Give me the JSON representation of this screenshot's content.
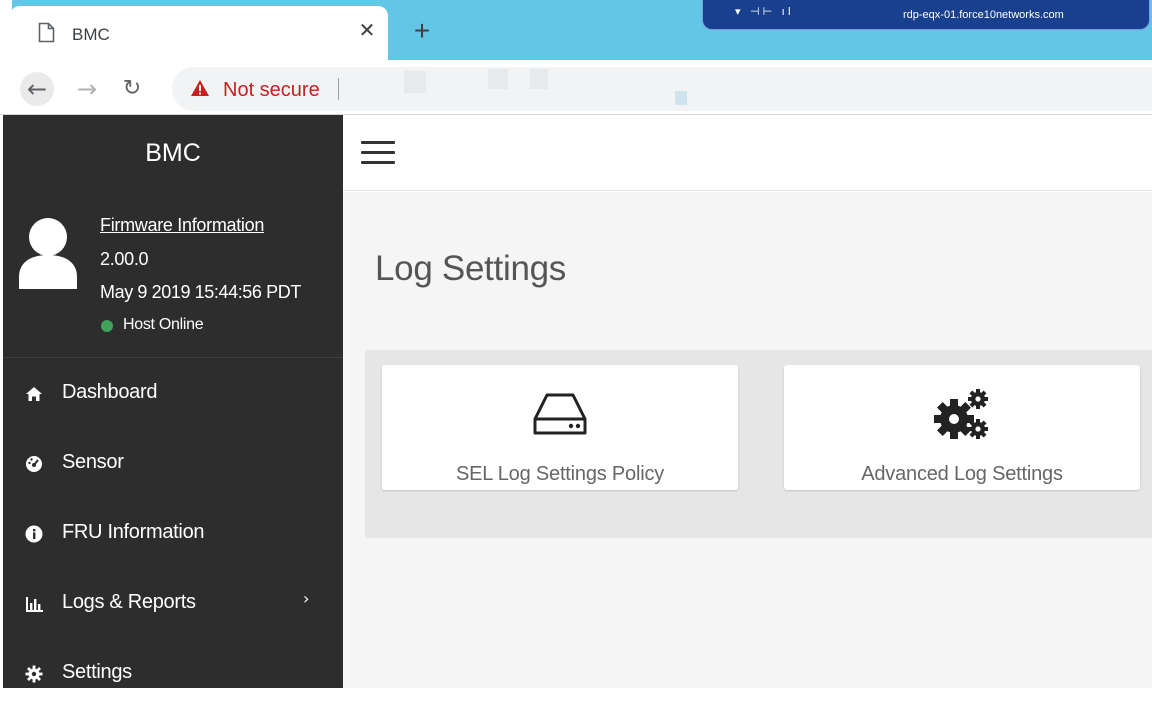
{
  "browser": {
    "tab_title": "BMC",
    "tab_close_icon": "close-icon",
    "new_tab_icon": "plus-icon",
    "security_label": "Not secure",
    "rdp_host": "rdp-eqx-01.force10networks.com"
  },
  "sidebar": {
    "brand": "BMC",
    "firmware": {
      "link_label": "Firmware Information",
      "version": "2.00.0",
      "build_date": "May 9 2019 15:44:56 PDT",
      "host_status": "Host Online",
      "host_status_color": "#3fa35c"
    },
    "items": [
      {
        "label": "Dashboard",
        "icon": "home-icon"
      },
      {
        "label": "Sensor",
        "icon": "gauge-icon"
      },
      {
        "label": "FRU Information",
        "icon": "info-icon"
      },
      {
        "label": "Logs & Reports",
        "icon": "bar-chart-icon",
        "has_submenu": true
      },
      {
        "label": "Settings",
        "icon": "gear-icon"
      }
    ]
  },
  "main": {
    "menu_icon": "hamburger-icon",
    "page_title": "Log Settings",
    "cards": [
      {
        "label": "SEL Log Settings Policy",
        "icon": "hard-drive-icon"
      },
      {
        "label": "Advanced Log Settings",
        "icon": "gears-icon"
      }
    ]
  },
  "colors": {
    "sidebar_bg": "#2d2d2d",
    "tabstrip_bg": "#62c6e6",
    "content_bg": "#f5f5f5",
    "warning_red": "#c5221f"
  }
}
